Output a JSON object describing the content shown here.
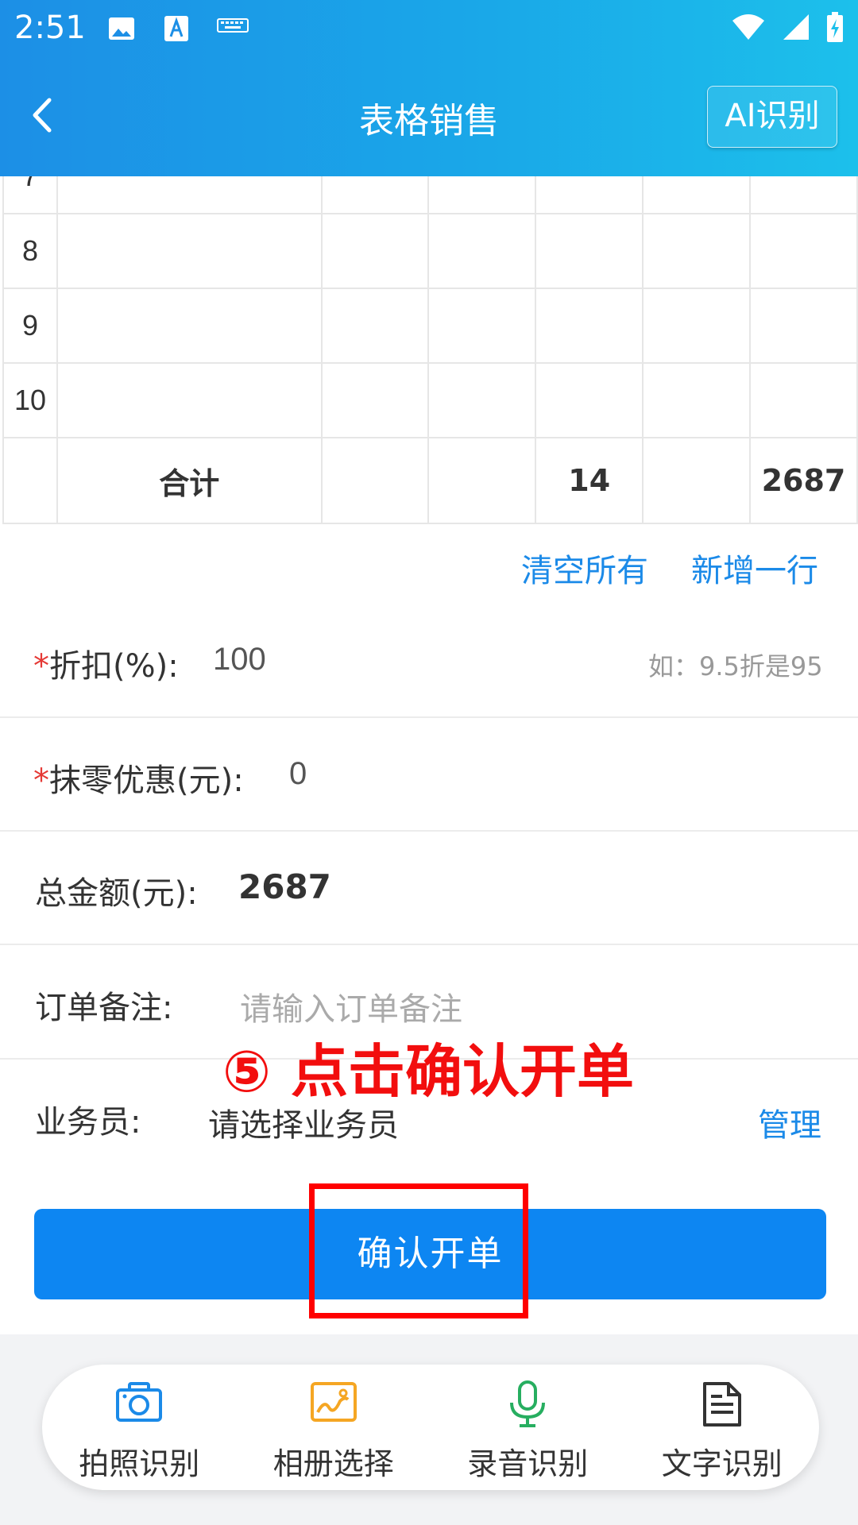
{
  "status_bar": {
    "time": "2:51"
  },
  "header": {
    "title": "表格销售",
    "ai_button": "AI识别"
  },
  "table": {
    "rows": [
      {
        "no": "7",
        "cells": [
          "",
          "",
          "",
          "",
          "",
          ""
        ]
      },
      {
        "no": "8",
        "cells": [
          "",
          "",
          "",
          "",
          "",
          ""
        ]
      },
      {
        "no": "9",
        "cells": [
          "",
          "",
          "",
          "",
          "",
          ""
        ]
      },
      {
        "no": "10",
        "cells": [
          "",
          "",
          "",
          "",
          "",
          ""
        ]
      }
    ],
    "total": {
      "label": "合计",
      "quantity": "14",
      "amount": "2687"
    }
  },
  "table_actions": {
    "clear_all": "清空所有",
    "add_row": "新增一行"
  },
  "form": {
    "discount": {
      "required_mark": "*",
      "label": "折扣(%):",
      "value": "100",
      "hint": "如：9.5折是95"
    },
    "rounding": {
      "required_mark": "*",
      "label": "抹零优惠(元):",
      "value": "0"
    },
    "total": {
      "label": "总金额(元):",
      "value": "2687"
    },
    "note": {
      "label": "订单备注:",
      "placeholder": "请输入订单备注"
    },
    "salesman": {
      "label": "业务员:",
      "placeholder": "请选择业务员",
      "manage": "管理"
    }
  },
  "annotation": "⑤ 点击确认开单",
  "submit_button": "确认开单",
  "bottom_tools": [
    {
      "label": "拍照识别",
      "icon": "camera-icon",
      "color": "#1b8ae8"
    },
    {
      "label": "相册选择",
      "icon": "gallery-icon",
      "color": "#f5a623"
    },
    {
      "label": "录音识别",
      "icon": "microphone-icon",
      "color": "#27ae60"
    },
    {
      "label": "文字识别",
      "icon": "document-icon",
      "color": "#333333"
    }
  ],
  "colors": {
    "primary": "#0d86f2",
    "link": "#1b8ae8",
    "required": "#e53935",
    "annotation": "#f20e0e"
  }
}
